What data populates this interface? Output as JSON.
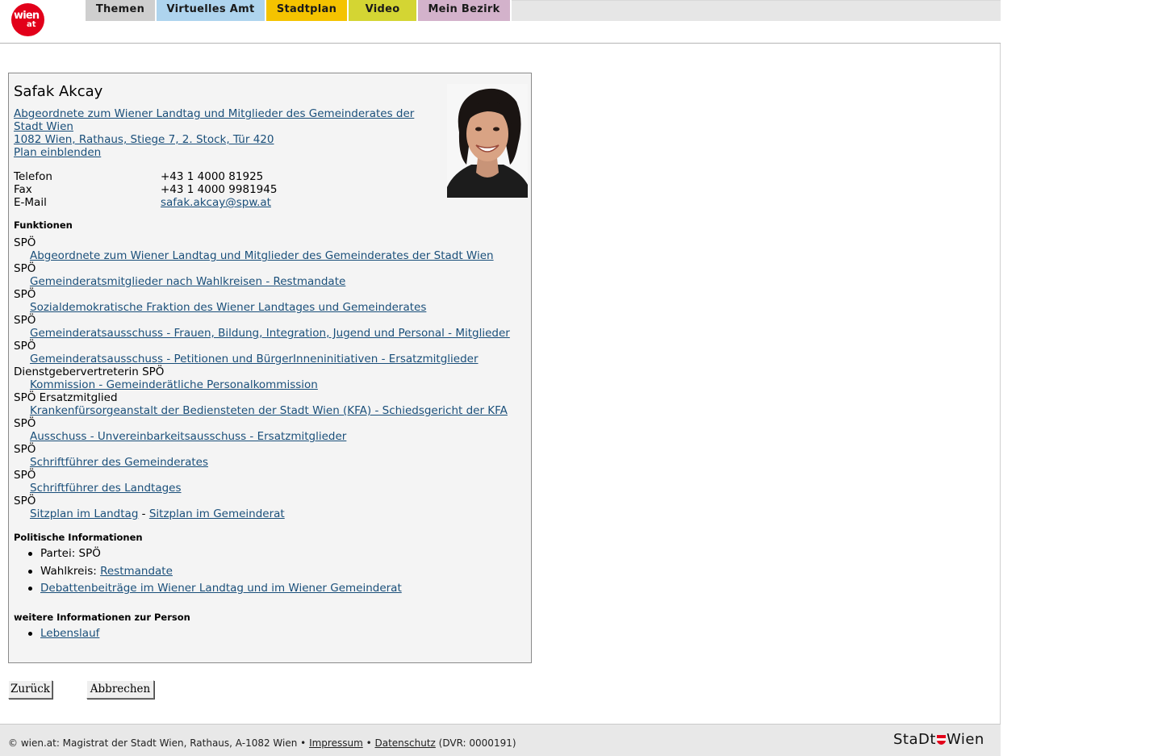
{
  "logo": {
    "word1": "wien",
    "word2": "at"
  },
  "nav": {
    "tabs": [
      {
        "label": "Themen",
        "color": "#cfcfcf"
      },
      {
        "label": "Virtuelles Amt",
        "color": "#aed4ee"
      },
      {
        "label": "Stadtplan",
        "color": "#f5c300"
      },
      {
        "label": "Video",
        "color": "#d4d533"
      },
      {
        "label": "Mein Bezirk",
        "color": "#d3b2cb"
      }
    ]
  },
  "person": {
    "name": "Safak Akcay",
    "title_link_line1": "Abgeordnete zum Wiener Landtag und Mitglieder des Gemeinderates der",
    "title_link_line2": "Stadt Wien ",
    "address_link": "1082 Wien, Rathaus, Stiege 7, 2. Stock, Tür 420",
    "plan_link": "Plan einblenden",
    "contact": {
      "phone_label": "Telefon",
      "phone": "+43 1 4000 81925",
      "fax_label": "Fax",
      "fax": "+43 1 4000 9981945",
      "email_label": "E-Mail",
      "email": "safak.akcay@spw.at"
    }
  },
  "functions": {
    "heading": "Funktionen",
    "items": [
      {
        "party": "SPÖ",
        "link": "Abgeordnete zum Wiener Landtag und Mitglieder des Gemeinderates der Stadt Wien"
      },
      {
        "party": "SPÖ",
        "link": "Gemeinderatsmitglieder nach Wahlkreisen - Restmandate"
      },
      {
        "party": "SPÖ",
        "link": "Sozialdemokratische Fraktion des Wiener Landtages und Gemeinderates"
      },
      {
        "party": "SPÖ",
        "link": "Gemeinderatsausschuss - Frauen, Bildung, Integration, Jugend und Personal - Mitglieder"
      },
      {
        "party": "SPÖ",
        "link": "Gemeinderatsausschuss - Petitionen und BürgerInneninitiativen - Ersatzmitglieder"
      },
      {
        "party": "Dienstgebervertreterin SPÖ",
        "link": "Kommission - Gemeinderätliche Personalkommission"
      },
      {
        "party": "SPÖ Ersatzmitglied",
        "link": "Krankenfürsorgeanstalt der Bediensteten der Stadt Wien (KFA) - Schiedsgericht der KFA"
      },
      {
        "party": "SPÖ",
        "link": "Ausschuss - Unvereinbarkeitsausschuss - Ersatzmitglieder"
      },
      {
        "party": "SPÖ",
        "link": "Schriftführer des Gemeinderates"
      },
      {
        "party": "SPÖ",
        "link": "Schriftführer des Landtages"
      }
    ],
    "last_party": "SPÖ",
    "seat_link_landtag": "Sitzplan im Landtag",
    "seat_sep": " - ",
    "seat_link_gemeinderat": "Sitzplan im Gemeinderat"
  },
  "political": {
    "heading": "Politische Informationen",
    "party_label": "Partei: SPÖ",
    "district_prefix": "Wahlkreis: ",
    "district_link": "Restmandate",
    "debate_link": "Debattenbeiträge im Wiener Landtag und im Wiener Gemeinderat"
  },
  "more": {
    "heading": "weitere Informationen zur Person",
    "cv_link": "Lebenslauf"
  },
  "buttons": {
    "back": "Zurück",
    "cancel": "Abbrechen"
  },
  "footer": {
    "text": "© wien.at: Magistrat der Stadt Wien, Rathaus, A-1082 Wien • ",
    "impressum": "Impressum",
    "sep": " • ",
    "datenschutz": "Datenschutz",
    "dvr": " (DVR: 0000191)",
    "logo_part1": "StaDt",
    "logo_part2": "Wien"
  }
}
